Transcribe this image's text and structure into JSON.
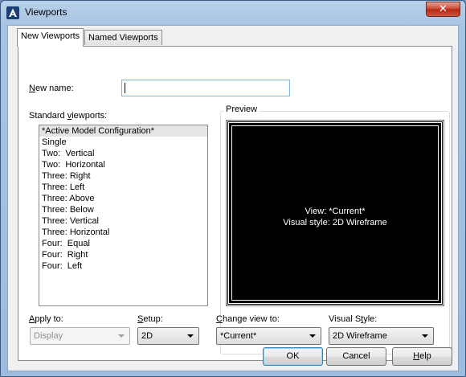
{
  "window": {
    "title": "Viewports"
  },
  "tabs": [
    {
      "label": "New Viewports",
      "active": true
    },
    {
      "label": "Named Viewports",
      "active": false
    }
  ],
  "new_name": {
    "label": "New name:",
    "mnemonic": "N",
    "rest": "ew name:",
    "value": ""
  },
  "standard_viewports": {
    "label_pre": "Standard ",
    "mnemonic": "v",
    "label_post": "iewports:",
    "items": [
      "*Active Model Configuration*",
      "Single",
      "Two:  Vertical",
      "Two:  Horizontal",
      "Three: Right",
      "Three: Left",
      "Three: Above",
      "Three: Below",
      "Three: Vertical",
      "Three: Horizontal",
      "Four:  Equal",
      "Four:  Right",
      "Four:  Left"
    ],
    "selected_index": 0
  },
  "preview": {
    "title": "Preview",
    "view_text": "View: *Current*",
    "style_text": "Visual style: 2D Wireframe"
  },
  "apply_to": {
    "mnemonic": "A",
    "rest": "pply to:",
    "value": "Display"
  },
  "setup": {
    "mnemonic": "S",
    "rest": "etup:",
    "value": "2D"
  },
  "change_view": {
    "mnemonic": "C",
    "rest": "hange view to:",
    "value": "*Current*"
  },
  "visual_style": {
    "pre": "Visual S",
    "mnemonic": "t",
    "post": "yle:",
    "value": "2D Wireframe"
  },
  "buttons": {
    "ok": "OK",
    "cancel": "Cancel",
    "help_mnemonic": "H",
    "help_rest": "elp"
  },
  "colors": {
    "title_bar": "#b9d1ea",
    "close_button": "#c7432f",
    "preview_bg": "#000000"
  },
  "icons": {
    "app": "autocad-a-icon",
    "close": "close-icon"
  }
}
